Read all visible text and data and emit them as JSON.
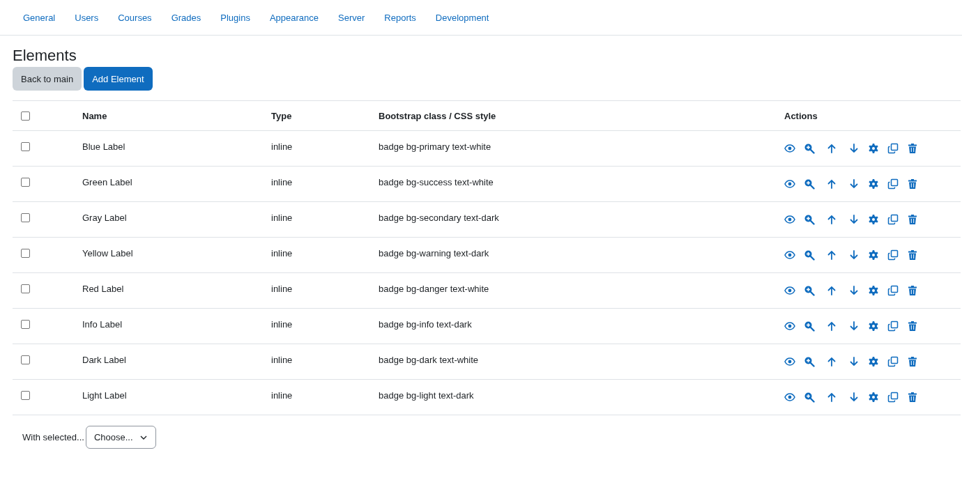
{
  "nav": {
    "tabs": [
      {
        "label": "General"
      },
      {
        "label": "Users"
      },
      {
        "label": "Courses"
      },
      {
        "label": "Grades"
      },
      {
        "label": "Plugins"
      },
      {
        "label": "Appearance"
      },
      {
        "label": "Server"
      },
      {
        "label": "Reports"
      },
      {
        "label": "Development"
      }
    ]
  },
  "heading": "Elements",
  "buttons": [
    {
      "label": "Back to main",
      "kind": "secondary"
    },
    {
      "label": "Add Element",
      "kind": "primary"
    }
  ],
  "table": {
    "select_all": {
      "checked": false
    },
    "columns": [
      "Name",
      "Type",
      "Bootstrap class / CSS style",
      "Actions"
    ],
    "rows": [
      {
        "checked": false,
        "name": "Blue Label",
        "type": "inline",
        "style": "badge bg-primary text-white"
      },
      {
        "checked": false,
        "name": "Green Label",
        "type": "inline",
        "style": "badge bg-success text-white"
      },
      {
        "checked": false,
        "name": "Gray Label",
        "type": "inline",
        "style": "badge bg-secondary text-dark"
      },
      {
        "checked": false,
        "name": "Yellow Label",
        "type": "inline",
        "style": "badge bg-warning text-dark"
      },
      {
        "checked": false,
        "name": "Red Label",
        "type": "inline",
        "style": "badge bg-danger text-white"
      },
      {
        "checked": false,
        "name": "Info Label",
        "type": "inline",
        "style": "badge bg-info text-dark"
      },
      {
        "checked": false,
        "name": "Dark Label",
        "type": "inline",
        "style": "badge bg-dark text-white"
      },
      {
        "checked": false,
        "name": "Light Label",
        "type": "inline",
        "style": "badge bg-light text-dark"
      }
    ]
  },
  "bulk": {
    "label": "With selected...",
    "select": "Choose..."
  }
}
